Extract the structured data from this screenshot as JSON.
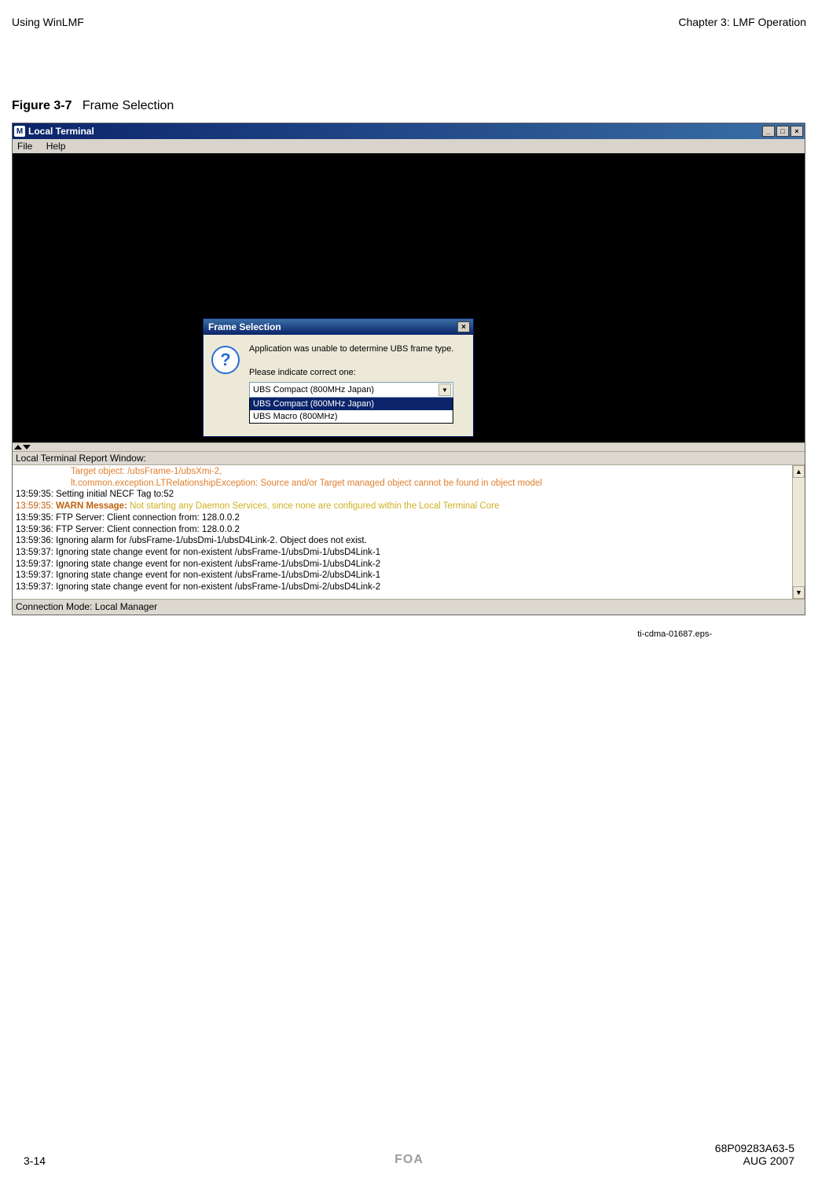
{
  "header": {
    "left": "Using WinLMF",
    "right": "Chapter 3: LMF Operation"
  },
  "figure": {
    "label": "Figure 3-7",
    "title": "Frame Selection"
  },
  "window": {
    "title": "Local Terminal",
    "menu": {
      "file": "File",
      "help": "Help"
    },
    "report_label": "Local Terminal Report Window:",
    "status": "Connection Mode: Local Manager"
  },
  "dialog": {
    "title": "Frame Selection",
    "msg1": "Application was unable to determine UBS frame type.",
    "msg2": "Please indicate correct one:",
    "selected": "UBS Compact (800MHz Japan)",
    "options": [
      "UBS Compact (800MHz Japan)",
      "UBS Macro (800MHz)"
    ]
  },
  "log": {
    "l1": "Target object: /ubsFrame-1/ubsXmi-2,",
    "l2": "lt.common.exception.LTRelationshipException: Source and/or Target managed object cannot be found in object model",
    "l3": "13:59:35: Setting initial NECF Tag to:52",
    "l4a": "13:59:35: ",
    "l4b": "WARN Message: ",
    "l4c": "Not starting any Daemon Services, since none are configured within the Local Terminal Core",
    "l5": "13:59:35: FTP Server: Client connection from: 128.0.0.2",
    "l6": "13:59:36: FTP Server: Client connection from: 128.0.0.2",
    "l7": "13:59:36: Ignoring alarm for /ubsFrame-1/ubsDmi-1/ubsD4Link-2.  Object does not exist.",
    "l8": "13:59:37: Ignoring state change event for non-existent /ubsFrame-1/ubsDmi-1/ubsD4Link-1",
    "l9": "13:59:37: Ignoring state change event for non-existent /ubsFrame-1/ubsDmi-1/ubsD4Link-2",
    "l10": "13:59:37: Ignoring state change event for non-existent /ubsFrame-1/ubsDmi-2/ubsD4Link-1",
    "l11": "13:59:37: Ignoring state change event for non-existent /ubsFrame-1/ubsDmi-2/ubsD4Link-2"
  },
  "caption": "ti-cdma-01687.eps-",
  "footer": {
    "page": "3-14",
    "docnum": "68P09283A63-5",
    "foa": "FOA",
    "date": "AUG 2007"
  }
}
